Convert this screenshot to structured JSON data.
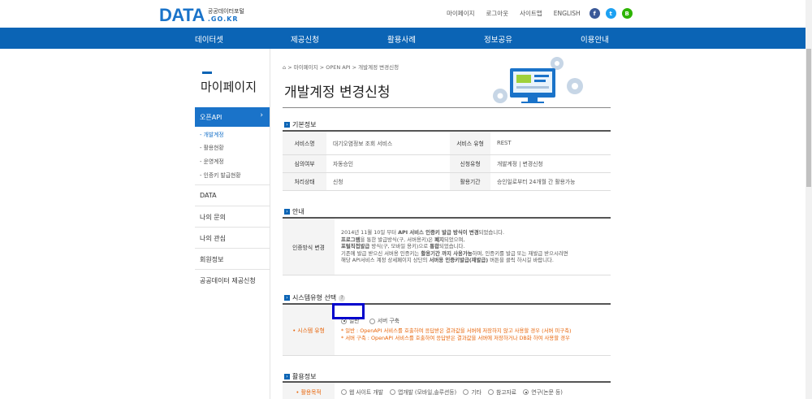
{
  "logo": {
    "main": "DATA",
    "sub_ko": "공공데이터포털",
    "sub_en": ".GO.KR"
  },
  "util_nav": [
    "마이페이지",
    "로그아웃",
    "사이트맵",
    "ENGLISH"
  ],
  "sns": [
    {
      "name": "facebook-icon",
      "glyph": "f",
      "color": "#3b5998"
    },
    {
      "name": "twitter-icon",
      "glyph": "t",
      "color": "#1da1f2"
    },
    {
      "name": "blog-icon",
      "glyph": "B",
      "color": "#2db400"
    }
  ],
  "gnb": [
    "데이터셋",
    "제공신청",
    "활용사례",
    "정보공유",
    "이용안내"
  ],
  "lnb": {
    "title": "마이페이지",
    "openapi": "오픈API",
    "openapi_chevron": "›",
    "subs": [
      "- 개발계정",
      "- 활용현황",
      "- 운영계정",
      "- 인증키 발급현황"
    ],
    "items": [
      "DATA",
      "나의 문의",
      "나의 관심",
      "회원정보",
      "공공데이터 제공신청"
    ]
  },
  "breadcrumb": "> 마이페이지 > OPEN API > 개발계정 변경신청",
  "breadcrumb_home_icon": "⌂",
  "page_title": "개발계정 변경신청",
  "section_icon": "›",
  "basic": {
    "heading": "기본정보",
    "rows": [
      {
        "l1": "서비스명",
        "v1": "대기오염정보 조회 서비스",
        "l2": "서비스 유형",
        "v2": "REST"
      },
      {
        "l1": "심의여부",
        "v1": "자동승인",
        "l2": "신청유형",
        "v2": "개발계정 | 변경신청"
      },
      {
        "l1": "처리상태",
        "v1": "신청",
        "l2": "활용기간",
        "v2": "승인일로부터 24개월 간 활용가능"
      }
    ]
  },
  "notice": {
    "heading": "안내",
    "label": "인증방식 변경",
    "l1a": "2014년 11월 10일 부터 ",
    "l1b": "API 서비스 인증키 발급 방식이 변경",
    "l1c": "되었습니다.",
    "l2a": "프로그램",
    "l2b": "을 통한 발급방식(구, 서버용키)은 ",
    "l2c": "폐지",
    "l2d": "되었으며,",
    "l3a": "포털직접발급",
    "l3b": " 방식(구, 모바일 용키)으로 ",
    "l3c": "통합",
    "l3d": "되었습니다.",
    "l4a": "기존에 발급 받으신 서버용 인증키는 ",
    "l4b": "활용기간 까지 사용가능",
    "l4c": "하며, 인증키를 발급 또는 재발급 받으시려면",
    "l5a": "해당 API서비스 계정 상세페이지 상단의 ",
    "l5b": "서버용 인증키발급(재발급)",
    "l5c": " 버튼을 클릭 하시길 바랍니다."
  },
  "system": {
    "heading": "시스템유형 선택",
    "help": "?",
    "label": "• 시스템 유형",
    "opt1": "일반",
    "opt2": "서버 구축",
    "desc1": "* 일반 : OpenAPI 서비스를 호출하여 응답받은 결과값을 서버에 저장하지 않고 사용할 경우 (서버 미구축)",
    "desc2": "* 서버 구축 : OpenAPI 서비스를 호출하여 응답받은 결과값을 서버에 저장하거나 DB화 하여 사용할 경우"
  },
  "usage": {
    "heading": "활용정보",
    "label": "• 활용목적",
    "options": [
      "웹 사이트 개발",
      "앱개발 (모바일,솔루션등)",
      "기타",
      "참고자료",
      "연구(논문 등)"
    ],
    "selected_index": 4
  }
}
